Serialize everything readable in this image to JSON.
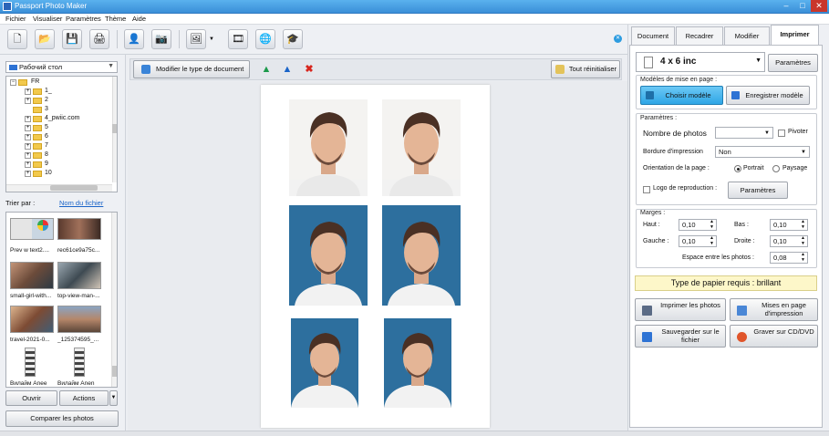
{
  "window": {
    "title": "Passport Photo Maker"
  },
  "menu": [
    "Fichier",
    "Visualiser",
    "Paramètres",
    "Thème",
    "Aide"
  ],
  "left": {
    "folder_select": "Рабочий стол",
    "tree": [
      "FR",
      "1_",
      "2",
      "3",
      "4_pwiic.com",
      "5",
      "6",
      "7",
      "8",
      "9",
      "10"
    ],
    "sort_label": "Trier par :",
    "sort_value": "Nom du fichier",
    "thumbnails": [
      "Prev w text2....",
      "rec61ce9a75c...",
      "small-girl-with...",
      "top-view-man-...",
      "travel-2021-0...",
      "_125374595_...",
      "Вилайм Anee",
      "Вилайм Anen"
    ],
    "ouvrir": "Ouvrir",
    "actions": "Actions",
    "compare": "Comparer les photos"
  },
  "center": {
    "modify_doc": "Modifier le type de document",
    "reset": "Tout réinitialiser"
  },
  "right": {
    "tabs": [
      "Document",
      "Recadrer",
      "Modifier",
      "Imprimer"
    ],
    "format": "4 x 6 inc",
    "params_btn": "Paramètres",
    "models_title": "Modèles de mise en page :",
    "choose_model": "Choisir modèle",
    "save_model": "Enregistrer modèle",
    "params_title": "Paramètres :",
    "nb_photos_label": "Nombre de photos",
    "pivoter": "Pivoter",
    "bordure_label": "Bordure d'impression",
    "bordure_value": "Non",
    "orientation_label": "Orientation de la page :",
    "portrait": "Portrait",
    "paysage": "Paysage",
    "logo_label": "Logo de reproduction :",
    "params_btn2": "Paramètres",
    "margins_title": "Marges :",
    "haut": "Haut :",
    "haut_val": "0,10",
    "bas": "Bas :",
    "bas_val": "0,10",
    "gauche": "Gauche :",
    "gauche_val": "0,10",
    "droite": "Droite :",
    "droite_val": "0,10",
    "space_label": "Espace entre les photos :",
    "space_val": "0,08",
    "paper_type": "Type de papier requis : brillant",
    "print_photos": "Imprimer les photos",
    "print_layout": "Mises en page d'impression",
    "save_file": "Sauvegarder sur le fichier",
    "burn_cd": "Graver sur CD/DVD"
  },
  "colors": {
    "accent": "#2ea6e6",
    "photo_blue": "#2d6f9e",
    "paper_yellow": "#fdf7c9"
  }
}
